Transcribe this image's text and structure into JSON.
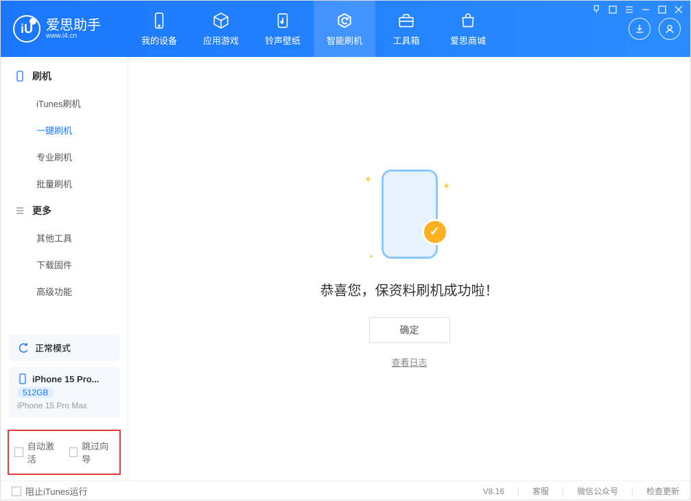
{
  "app": {
    "name": "爱思助手",
    "url": "www.i4.cn"
  },
  "top_tabs": [
    {
      "label": "我的设备"
    },
    {
      "label": "应用游戏"
    },
    {
      "label": "铃声壁纸"
    },
    {
      "label": "智能刷机"
    },
    {
      "label": "工具箱"
    },
    {
      "label": "爱思商城"
    }
  ],
  "sidebar": {
    "group1_title": "刷机",
    "items1": [
      "iTunes刷机",
      "一键刷机",
      "专业刷机",
      "批量刷机"
    ],
    "group2_title": "更多",
    "items2": [
      "其他工具",
      "下载固件",
      "高级功能"
    ]
  },
  "mode": {
    "label": "正常模式"
  },
  "device": {
    "name": "iPhone 15 Pro...",
    "storage": "512GB",
    "model": "iPhone 15 Pro Max"
  },
  "red_opts": {
    "auto_activate": "自动激活",
    "skip_wizard": "跳过向导"
  },
  "main": {
    "success": "恭喜您，保资料刷机成功啦！",
    "confirm": "确定",
    "view_log": "查看日志"
  },
  "footer": {
    "block_itunes": "阻止iTunes运行",
    "version": "V8.16",
    "support": "客服",
    "wechat": "微信公众号",
    "check_update": "检查更新"
  }
}
